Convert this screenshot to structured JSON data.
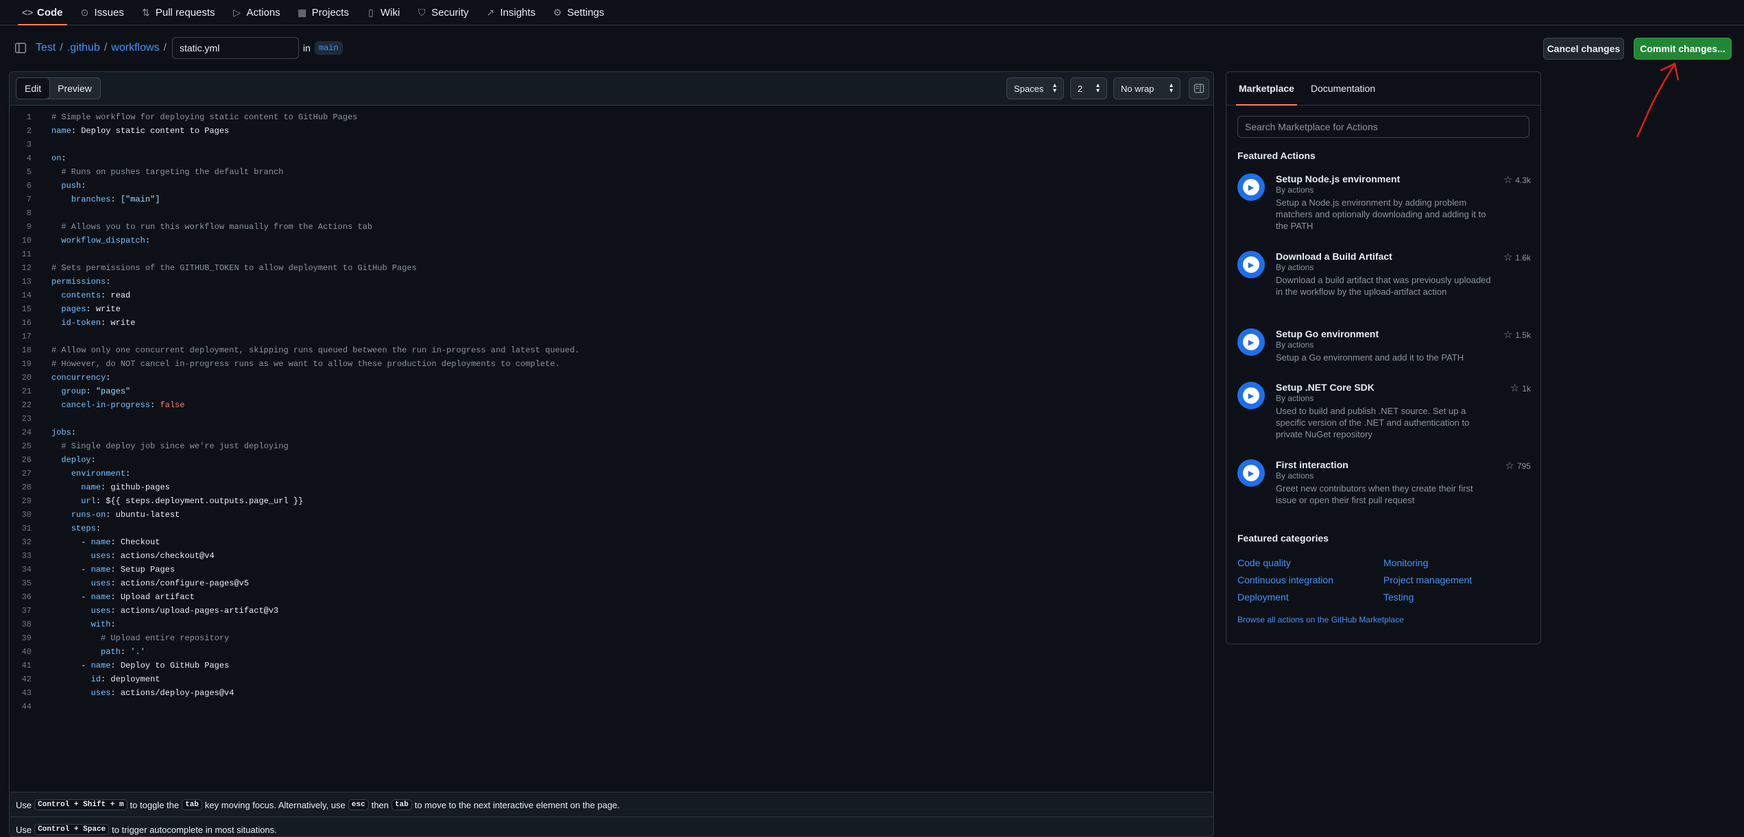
{
  "nav": [
    {
      "label": "Code",
      "icon": "code-icon",
      "glyph": "<>"
    },
    {
      "label": "Issues",
      "icon": "issue-icon",
      "glyph": "⊙"
    },
    {
      "label": "Pull requests",
      "icon": "pull-request-icon",
      "glyph": "⇅"
    },
    {
      "label": "Actions",
      "icon": "play-icon",
      "glyph": "▷"
    },
    {
      "label": "Projects",
      "icon": "table-icon",
      "glyph": "▦"
    },
    {
      "label": "Wiki",
      "icon": "book-icon",
      "glyph": "▯"
    },
    {
      "label": "Security",
      "icon": "shield-icon",
      "glyph": "⛉"
    },
    {
      "label": "Insights",
      "icon": "graph-icon",
      "glyph": "↗"
    },
    {
      "label": "Settings",
      "icon": "gear-icon",
      "glyph": "⚙"
    }
  ],
  "breadcrumb": {
    "repo": "Test",
    "dir1": ".github",
    "dir2": "workflows",
    "sep": "/"
  },
  "filename": "static.yml",
  "in_text": "in",
  "branch": "main",
  "buttons": {
    "cancel": "Cancel changes",
    "commit": "Commit changes..."
  },
  "editor": {
    "edit_tab": "Edit",
    "preview_tab": "Preview",
    "indent_mode": "Spaces",
    "indent_size": "2",
    "wrap_mode": "No wrap"
  },
  "code_lines": [
    "# Simple workflow for deploying static content to GitHub Pages",
    "name: Deploy static content to Pages",
    "",
    "on:",
    "  # Runs on pushes targeting the default branch",
    "  push:",
    "    branches: [\"main\"]",
    "",
    "  # Allows you to run this workflow manually from the Actions tab",
    "  workflow_dispatch:",
    "",
    "# Sets permissions of the GITHUB_TOKEN to allow deployment to GitHub Pages",
    "permissions:",
    "  contents: read",
    "  pages: write",
    "  id-token: write",
    "",
    "# Allow only one concurrent deployment, skipping runs queued between the run in-progress and latest queued.",
    "# However, do NOT cancel in-progress runs as we want to allow these production deployments to complete.",
    "concurrency:",
    "  group: \"pages\"",
    "  cancel-in-progress: false",
    "",
    "jobs:",
    "  # Single deploy job since we're just deploying",
    "  deploy:",
    "    environment:",
    "      name: github-pages",
    "      url: ${{ steps.deployment.outputs.page_url }}",
    "    runs-on: ubuntu-latest",
    "    steps:",
    "      - name: Checkout",
    "        uses: actions/checkout@v4",
    "      - name: Setup Pages",
    "        uses: actions/configure-pages@v5",
    "      - name: Upload artifact",
    "        uses: actions/upload-pages-artifact@v3",
    "        with:",
    "          # Upload entire repository",
    "          path: '.'",
    "      - name: Deploy to GitHub Pages",
    "        id: deployment",
    "        uses: actions/deploy-pages@v4",
    ""
  ],
  "hints": {
    "line1": {
      "pre": "Use",
      "k1": "Control + Shift + m",
      "mid1": "to toggle the",
      "k2": "tab",
      "mid2": "key moving focus. Alternatively, use",
      "k3": "esc",
      "mid3": "then",
      "k4": "tab",
      "post": "to move to the next interactive element on the page."
    },
    "line2": {
      "pre": "Use",
      "k1": "Control + Space",
      "post": "to trigger autocomplete in most situations."
    }
  },
  "panel": {
    "tabs": [
      "Marketplace",
      "Documentation"
    ],
    "search_placeholder": "Search Marketplace for Actions",
    "featured_actions_title": "Featured Actions",
    "actions": [
      {
        "name": "Setup Node.js environment",
        "by": "By actions",
        "desc": "Setup a Node.js environment by adding problem matchers and optionally downloading and adding it to the PATH",
        "stars": "4.3k"
      },
      {
        "name": "Download a Build Artifact",
        "by": "By actions",
        "desc": "Download a build artifact that was previously uploaded in the workflow by the upload-artifact action",
        "stars": "1.6k"
      },
      {
        "name": "Setup Go environment",
        "by": "By actions",
        "desc": "Setup a Go environment and add it to the PATH",
        "stars": "1.5k"
      },
      {
        "name": "Setup .NET Core SDK",
        "by": "By actions",
        "desc": "Used to build and publish .NET source. Set up a specific version of the .NET and authentication to private NuGet repository",
        "stars": "1k"
      },
      {
        "name": "First interaction",
        "by": "By actions",
        "desc": "Greet new contributors when they create their first issue or open their first pull request",
        "stars": "795"
      }
    ],
    "featured_categories_title": "Featured categories",
    "categories": [
      "Code quality",
      "Monitoring",
      "Continuous integration",
      "Project management",
      "Deployment",
      "Testing"
    ],
    "browse_link": "Browse all actions on the GitHub Marketplace"
  },
  "colors": {
    "accent": "#f78166",
    "link": "#4493f8",
    "commit_button": "#238636",
    "annotation_arrow": "#e11d1d"
  }
}
